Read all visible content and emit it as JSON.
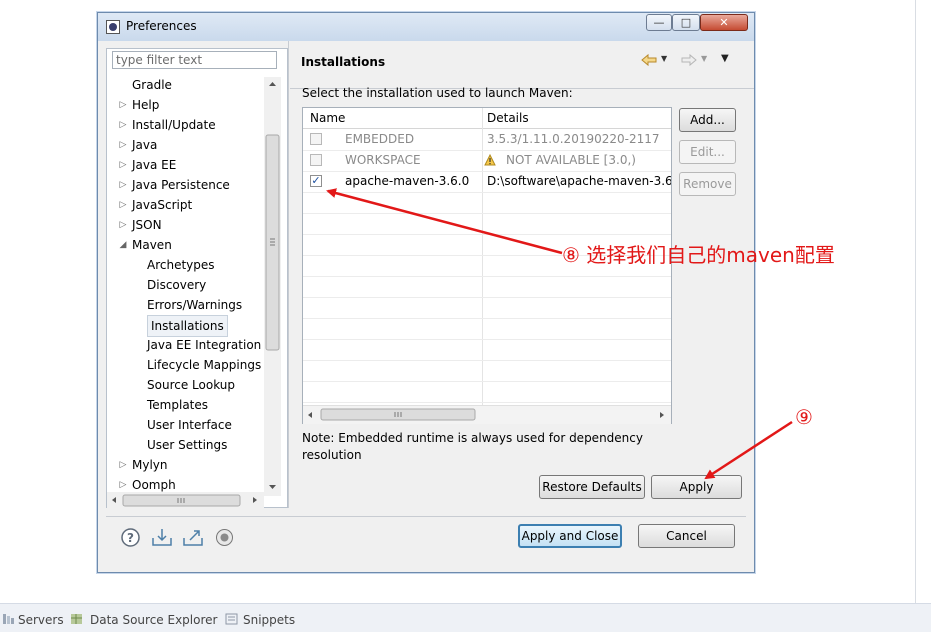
{
  "window": {
    "title": "Preferences",
    "min_label": "—",
    "max_label": "□",
    "close_label": "✕"
  },
  "filter": {
    "placeholder": "type filter text"
  },
  "tree": {
    "items": [
      {
        "label": "Gradle",
        "arrow": "",
        "indent": 1
      },
      {
        "label": "Help",
        "arrow": "▷",
        "indent": 1
      },
      {
        "label": "Install/Update",
        "arrow": "▷",
        "indent": 1
      },
      {
        "label": "Java",
        "arrow": "▷",
        "indent": 1
      },
      {
        "label": "Java EE",
        "arrow": "▷",
        "indent": 1
      },
      {
        "label": "Java Persistence",
        "arrow": "▷",
        "indent": 1
      },
      {
        "label": "JavaScript",
        "arrow": "▷",
        "indent": 1
      },
      {
        "label": "JSON",
        "arrow": "▷",
        "indent": 1
      },
      {
        "label": "Maven",
        "arrow": "◢",
        "indent": 1
      },
      {
        "label": "Archetypes",
        "arrow": "",
        "indent": 2
      },
      {
        "label": "Discovery",
        "arrow": "",
        "indent": 2
      },
      {
        "label": "Errors/Warnings",
        "arrow": "",
        "indent": 2
      },
      {
        "label": "Installations",
        "arrow": "",
        "indent": 2,
        "selected": true
      },
      {
        "label": "Java EE Integration",
        "arrow": "",
        "indent": 2
      },
      {
        "label": "Lifecycle Mappings",
        "arrow": "",
        "indent": 2
      },
      {
        "label": "Source Lookup",
        "arrow": "",
        "indent": 2
      },
      {
        "label": "Templates",
        "arrow": "",
        "indent": 2
      },
      {
        "label": "User Interface",
        "arrow": "",
        "indent": 2
      },
      {
        "label": "User Settings",
        "arrow": "",
        "indent": 2
      },
      {
        "label": "Mylyn",
        "arrow": "▷",
        "indent": 1
      },
      {
        "label": "Oomph",
        "arrow": "▷",
        "indent": 1
      }
    ]
  },
  "page": {
    "title": "Installations",
    "description": "Select the installation used to launch Maven:",
    "note": "Note: Embedded runtime is always used for dependency resolution"
  },
  "table": {
    "columns": [
      "Name",
      "Details"
    ],
    "rows": [
      {
        "name": "EMBEDDED",
        "details": "3.5.3/1.11.0.20190220-2117",
        "checked": false,
        "disabled": true
      },
      {
        "name": "WORKSPACE",
        "details": "NOT AVAILABLE [3.0,)",
        "checked": false,
        "disabled": true,
        "warning": true
      },
      {
        "name": "apache-maven-3.6.0",
        "details": "D:\\software\\apache-maven-3.6.",
        "checked": true,
        "disabled": false
      }
    ]
  },
  "buttons": {
    "add": "Add...",
    "edit": "Edit...",
    "remove": "Remove",
    "restore_defaults": "Restore Defaults",
    "apply": "Apply",
    "apply_and_close": "Apply and Close",
    "cancel": "Cancel"
  },
  "annotations": {
    "step8": "⑧ 选择我们自己的maven配置",
    "step9": "⑨",
    "color": "#e21818"
  },
  "bottom_views": [
    "Servers",
    "Data Source Explorer",
    "Snippets"
  ]
}
